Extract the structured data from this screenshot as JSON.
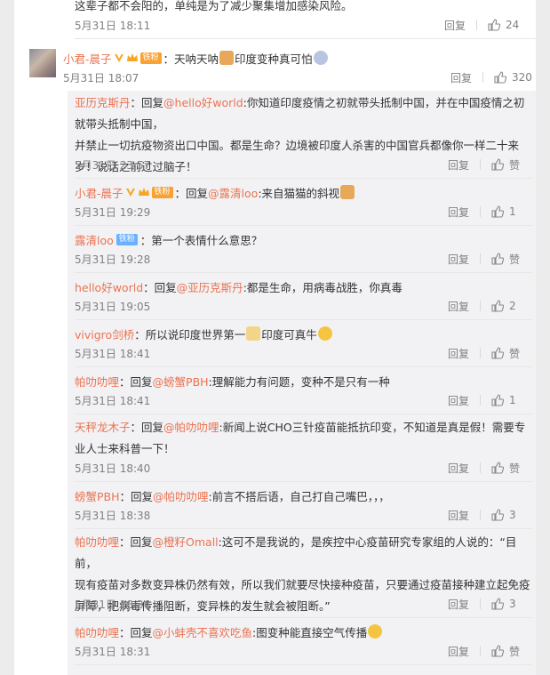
{
  "top_comment_tail": {
    "text": "这辈子都不会阳的，单纯是为了减少聚集增加感染风险。",
    "time": "5月31日 18:11",
    "reply_label": "回复",
    "likes": "24"
  },
  "main_comment": {
    "user": "小君-晨子",
    "fan_badge": "铁粉",
    "text_a": "：天呐天呐",
    "text_b": "印度变种真可怕",
    "time": "5月31日 18:07",
    "reply_label": "回复",
    "likes": "320"
  },
  "replies": [
    {
      "user": "亚历克斯丹",
      "prefix": "：回复",
      "mention": "@hello好world",
      "text": ":你知道印度疫情之初就带头抵制中国，并在中国疫情之初就带头抵制中国，",
      "text2": "并禁止一切抗疫物资出口中国。都是生命？边境被印度人杀害的中国官兵都像你一样二十来",
      "text3": "岁！说话之前过过脑子！",
      "time": "5月31日 23:57",
      "reply_label": "回复",
      "likes": "赞"
    },
    {
      "user": "小君-晨子",
      "fan_badge": "铁粉",
      "prefix": "：回复",
      "mention": "@露清loo",
      "text": ":来自猫猫的斜视",
      "time": "5月31日 19:29",
      "reply_label": "回复",
      "likes": "1"
    },
    {
      "user": "露清loo",
      "tie_badge": "铁粉",
      "prefix": "：第一个表情什么意思？",
      "time": "5月31日 19:28",
      "reply_label": "回复",
      "likes": "赞"
    },
    {
      "user": "hello好world",
      "prefix": "：回复",
      "mention": "@亚历克斯丹",
      "text": ":都是生命，用病毒战胜，你真毒",
      "time": "5月31日 19:05",
      "reply_label": "回复",
      "likes": "2"
    },
    {
      "user": "vivigro剑桥",
      "prefix": "：所以说印度世界第一",
      "text": "印度可真牛",
      "time": "5月31日 18:41",
      "reply_label": "回复",
      "likes": "赞"
    },
    {
      "user": "帕叻叻哩",
      "prefix": "：回复",
      "mention": "@螃蟹PBH",
      "text": ":理解能力有问题，变种不是只有一种",
      "time": "5月31日 18:41",
      "reply_label": "回复",
      "likes": "1"
    },
    {
      "user": "天秤龙木子",
      "prefix": "：回复",
      "mention": "@帕叻叻哩",
      "text": ":新闻上说CHO三针疫苗能抵抗印变，不知道是真是假！需要专",
      "text2": "业人士来科普一下！",
      "time": "5月31日 18:40",
      "reply_label": "回复",
      "likes": "赞"
    },
    {
      "user": "螃蟹PBH",
      "prefix": "：回复",
      "mention": "@帕叻叻哩",
      "text": ":前言不搭后语，自己打自己嘴巴，，，",
      "time": "5月31日 18:38",
      "reply_label": "回复",
      "likes": "3"
    },
    {
      "user": "帕叻叻哩",
      "prefix": "：回复",
      "mention": "@橙籽Omall",
      "text": ":这可不是我说的，是疾控中心疫苗研究专家组的人说的：“目前，",
      "text2": "现有疫苗对多数变异株仍然有效，所以我们就要尽快接种疫苗，只要通过疫苗接种建立起免疫",
      "text3": "屏障，把病毒传播阻断，变异株的发生就会被阻断。”",
      "time": "5月31日 18:36",
      "reply_label": "回复",
      "likes": "3"
    },
    {
      "user": "帕叻叻哩",
      "prefix": "：回复",
      "mention": "@小蚌壳不喜欢吃鱼",
      "text": ":图变种能直接空气传播",
      "time": "5月31日 18:31",
      "reply_label": "回复",
      "likes": "赞"
    }
  ],
  "colors": {
    "link": "#eb7350",
    "bg": "#ececec",
    "sub_bg": "#f2f2f5"
  }
}
